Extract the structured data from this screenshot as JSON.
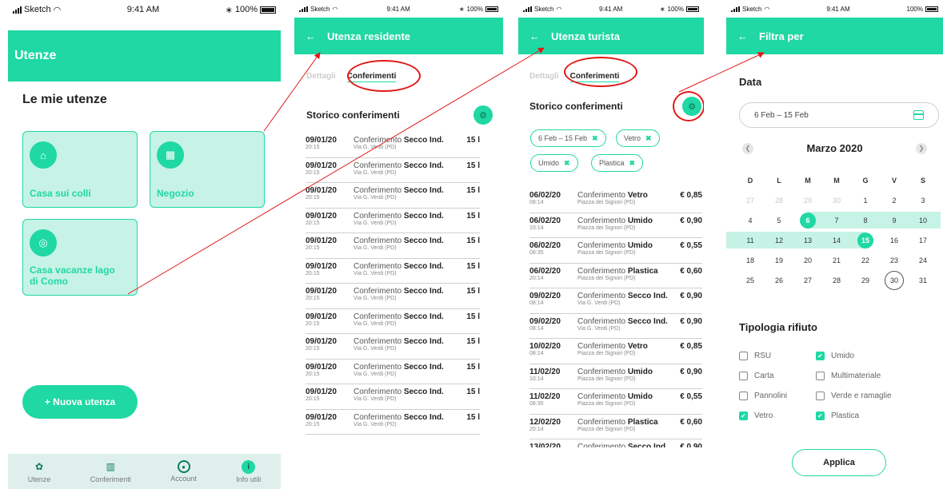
{
  "status": {
    "carrier": "Sketch",
    "time": "9:41 AM",
    "battery": "100%"
  },
  "screen1": {
    "title": "Utenze",
    "heading": "Le mie utenze",
    "cards": [
      {
        "label": "Casa sui colli",
        "icon": "home-icon"
      },
      {
        "label": "Negozio",
        "icon": "shop-icon"
      },
      {
        "label": "Casa vacanze lago di Como",
        "icon": "umbrella-icon"
      }
    ],
    "new_button": "+ Nuova utenza",
    "nav": [
      {
        "label": "Utenze",
        "icon": "users-icon"
      },
      {
        "label": "Conferimenti",
        "icon": "trash-icon"
      },
      {
        "label": "Account",
        "icon": "account-icon"
      },
      {
        "label": "Info utili",
        "icon": "info-icon"
      }
    ]
  },
  "screen2": {
    "title": "Utenza residente",
    "tab_details": "Dettagli",
    "tab_active": "Conferimenti",
    "section_title": "Storico conferimenti",
    "rows": [
      {
        "date": "09/01/20",
        "time": "20:15",
        "prefix": "Conferimento",
        "type": "Secco Ind.",
        "address": "Via G. Verdi (PD)",
        "value": "15 l"
      },
      {
        "date": "09/01/20",
        "time": "20:15",
        "prefix": "Conferimento",
        "type": "Secco Ind.",
        "address": "Via G. Verdi (PD)",
        "value": "15 l"
      },
      {
        "date": "09/01/20",
        "time": "20:15",
        "prefix": "Conferimento",
        "type": "Secco Ind.",
        "address": "Via G. Verdi (PD)",
        "value": "15 l"
      },
      {
        "date": "09/01/20",
        "time": "20:15",
        "prefix": "Conferimento",
        "type": "Secco Ind.",
        "address": "Via G. Verdi (PD)",
        "value": "15 l"
      },
      {
        "date": "09/01/20",
        "time": "20:15",
        "prefix": "Conferimento",
        "type": "Secco Ind.",
        "address": "Via G. Verdi (PD)",
        "value": "15 l"
      },
      {
        "date": "09/01/20",
        "time": "20:15",
        "prefix": "Conferimento",
        "type": "Secco Ind.",
        "address": "Via G. Verdi (PD)",
        "value": "15 l"
      },
      {
        "date": "09/01/20",
        "time": "20:15",
        "prefix": "Conferimento",
        "type": "Secco Ind.",
        "address": "Via G. Verdi (PD)",
        "value": "15 l"
      },
      {
        "date": "09/01/20",
        "time": "20:15",
        "prefix": "Conferimento",
        "type": "Secco Ind.",
        "address": "Via G. Verdi (PD)",
        "value": "15 l"
      },
      {
        "date": "09/01/20",
        "time": "20:15",
        "prefix": "Conferimento",
        "type": "Secco Ind.",
        "address": "Via G. Verdi (PD)",
        "value": "15 l"
      },
      {
        "date": "09/01/20",
        "time": "20:15",
        "prefix": "Conferimento",
        "type": "Secco Ind.",
        "address": "Via G. Verdi (PD)",
        "value": "15 l"
      },
      {
        "date": "09/01/20",
        "time": "20:15",
        "prefix": "Conferimento",
        "type": "Secco Ind.",
        "address": "Via G. Verdi (PD)",
        "value": "15 l"
      },
      {
        "date": "09/01/20",
        "time": "20:15",
        "prefix": "Conferimento",
        "type": "Secco Ind.",
        "address": "Via G. Verdi (PD)",
        "value": "15 l"
      }
    ]
  },
  "screen3": {
    "title": "Utenza turista",
    "tab_details": "Dettagli",
    "tab_active": "Conferimenti",
    "section_title": "Storico conferimenti",
    "chips": [
      "6 Feb – 15 Feb",
      "Vetro",
      "Umido",
      "Plastica"
    ],
    "rows": [
      {
        "date": "06/02/20",
        "time": "08:14",
        "prefix": "Conferimento",
        "type": "Vetro",
        "address": "Piazza dei Signori (PD)",
        "value": "€ 0,85"
      },
      {
        "date": "06/02/20",
        "time": "10:14",
        "prefix": "Conferimento",
        "type": "Umido",
        "address": "Piazza dei Signori (PD)",
        "value": "€ 0,90"
      },
      {
        "date": "06/02/20",
        "time": "08:35",
        "prefix": "Conferimento",
        "type": "Umido",
        "address": "Piazza dei Signori (PD)",
        "value": "€ 0,55"
      },
      {
        "date": "06/02/20",
        "time": "20:14",
        "prefix": "Conferimento",
        "type": "Plastica",
        "address": "Piazza dei Signori (PD)",
        "value": "€ 0,60"
      },
      {
        "date": "09/02/20",
        "time": "08:14",
        "prefix": "Conferimento",
        "type": "Secco Ind.",
        "address": "Via G. Verdi (PD)",
        "value": "€ 0,90"
      },
      {
        "date": "09/02/20",
        "time": "08:14",
        "prefix": "Conferimento",
        "type": "Secco Ind.",
        "address": "Via G. Verdi (PD)",
        "value": "€ 0,90"
      },
      {
        "date": "10/02/20",
        "time": "08:14",
        "prefix": "Conferimento",
        "type": "Vetro",
        "address": "Piazza dei Signori (PD)",
        "value": "€ 0,85"
      },
      {
        "date": "11/02/20",
        "time": "10:14",
        "prefix": "Conferimento",
        "type": "Umido",
        "address": "Piazza dei Signori (PD)",
        "value": "€ 0,90"
      },
      {
        "date": "11/02/20",
        "time": "08:35",
        "prefix": "Conferimento",
        "type": "Umido",
        "address": "Piazza dei Signori (PD)",
        "value": "€ 0,55"
      },
      {
        "date": "12/02/20",
        "time": "20:14",
        "prefix": "Conferimento",
        "type": "Plastica",
        "address": "Piazza dei Signori (PD)",
        "value": "€ 0,60"
      },
      {
        "date": "13/02/20",
        "time": "08:14",
        "prefix": "Conferimento",
        "type": "Secco Ind.",
        "address": "Via G. Verdi (PD)",
        "value": "€ 0,90"
      }
    ]
  },
  "screen4": {
    "title": "Filtra per",
    "data_label": "Data",
    "date_value": "6 Feb – 15 Feb",
    "month": "Marzo 2020",
    "weekdays": [
      "D",
      "L",
      "M",
      "M",
      "G",
      "V",
      "S"
    ],
    "weeks": [
      [
        "27",
        "28",
        "29",
        "30",
        "1",
        "2",
        "3"
      ],
      [
        "4",
        "5",
        "6",
        "7",
        "8",
        "9",
        "10"
      ],
      [
        "11",
        "12",
        "13",
        "14",
        "15",
        "16",
        "17"
      ],
      [
        "18",
        "19",
        "20",
        "21",
        "22",
        "23",
        "24"
      ],
      [
        "25",
        "26",
        "27",
        "28",
        "29",
        "30",
        "31"
      ]
    ],
    "range_start": "6",
    "range_end": "15",
    "today": "30",
    "type_label": "Tipologia rifiuto",
    "options": [
      {
        "label": "RSU",
        "checked": false
      },
      {
        "label": "Umido",
        "checked": true
      },
      {
        "label": "Carta",
        "checked": false
      },
      {
        "label": "Multimateriale",
        "checked": false
      },
      {
        "label": "Pannolini",
        "checked": false
      },
      {
        "label": "Verde e ramaglie",
        "checked": false
      },
      {
        "label": "Vetro",
        "checked": true
      },
      {
        "label": "Plastica",
        "checked": true
      }
    ],
    "apply": "Applica"
  },
  "colors": {
    "accent": "#1fd8a4",
    "accent_light": "#c6f3e6",
    "annotation": "#e21818"
  }
}
